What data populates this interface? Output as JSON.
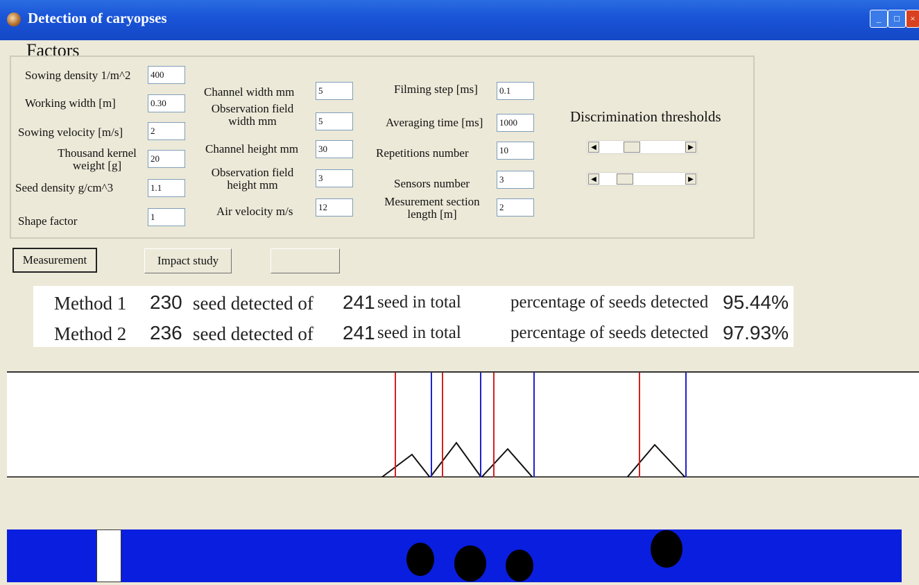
{
  "window": {
    "title": "Detection of caryopses"
  },
  "factors": {
    "group_label": "Factors",
    "col1": [
      {
        "label": "Sowing density 1/m^2",
        "value": "400"
      },
      {
        "label": "Working width [m]",
        "value": "0.30"
      },
      {
        "label": "Sowing velocity [m/s]",
        "value": "2"
      },
      {
        "label": "Thousand kernel weight [g]",
        "value": "20"
      },
      {
        "label": "Seed density g/cm^3",
        "value": "1.1"
      },
      {
        "label": "Shape factor",
        "value": "1"
      }
    ],
    "col2": [
      {
        "label": "Channel width mm",
        "value": "5"
      },
      {
        "label": "Observation field width  mm",
        "value": "5"
      },
      {
        "label": "Channel height mm",
        "value": "30"
      },
      {
        "label": "Observation field height  mm",
        "value": "3"
      },
      {
        "label": "Air velocity m/s",
        "value": "12"
      }
    ],
    "col3": [
      {
        "label": "Filming step [ms]",
        "value": "0.1"
      },
      {
        "label": "Averaging time [ms]",
        "value": "1000"
      },
      {
        "label": "Repetitions number",
        "value": "10"
      },
      {
        "label": "Sensors number",
        "value": "3"
      },
      {
        "label": "Mesurement section length [m]",
        "value": "2"
      }
    ],
    "discrimination": {
      "title": "Discrimination thresholds",
      "slider1_position": 0.35,
      "slider2_position": 0.25
    }
  },
  "buttons": {
    "measurement": "Measurement",
    "impact": "Impact study",
    "blank": ""
  },
  "results": [
    {
      "method": "Method 1",
      "detected": "230",
      "detected_text": "seed detected of",
      "total": "241",
      "total_text": "seed in total",
      "pct_text": "percentage of seeds detected",
      "pct": "95.44%"
    },
    {
      "method": "Method 2",
      "detected": "236",
      "detected_text": "seed detected of",
      "total": "241",
      "total_text": "seed in total",
      "pct_text": "percentage of seeds detected",
      "pct": "97.93%"
    }
  ],
  "colors": {
    "title_bar": "#1a55d8",
    "channel": "#0a1ee0",
    "marker_red": "#d22020",
    "marker_blue": "#2020c8",
    "seed": "#000000"
  }
}
